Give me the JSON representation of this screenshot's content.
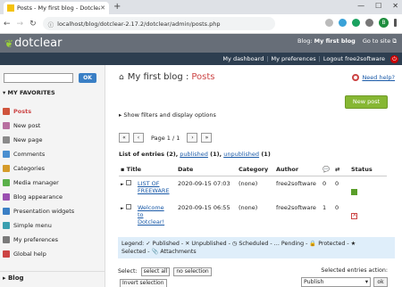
{
  "browser": {
    "tab_title": "Posts - My first blog - Dotclear",
    "url": "localhost/blog/dotclear-2.17.2/dotclear/admin/posts.php",
    "profile_initial": "B"
  },
  "header": {
    "logo": "dotclear",
    "blog_label": "Blog:",
    "blog_name": "My first blog",
    "goto_site": "Go to site",
    "my_dashboard": "My dashboard",
    "my_preferences": "My preferences",
    "logout": "Logout free2software"
  },
  "sidebar": {
    "search_placeholder": "",
    "ok": "OK",
    "favorites_title": "MY FAVORITES",
    "items": [
      {
        "label": "Posts",
        "color": "#d0543c"
      },
      {
        "label": "New post",
        "color": "#b86fa0"
      },
      {
        "label": "New page",
        "color": "#8a8a8a"
      },
      {
        "label": "Comments",
        "color": "#4a8fd0"
      },
      {
        "label": "Categories",
        "color": "#d59b2a"
      },
      {
        "label": "Media manager",
        "color": "#5ab04a"
      },
      {
        "label": "Blog appearance",
        "color": "#9a4fb0"
      },
      {
        "label": "Presentation widgets",
        "color": "#3a7fc5"
      },
      {
        "label": "Simple menu",
        "color": "#3a9fb0"
      },
      {
        "label": "My preferences",
        "color": "#7a7a7a"
      },
      {
        "label": "Global help",
        "color": "#c44"
      }
    ],
    "blog_title": "Blog"
  },
  "main": {
    "blog_name": "My first blog",
    "page_title": "Posts",
    "help": "Need help?",
    "new_post": "New post",
    "filters": "Show filters and display options",
    "pager": {
      "first": "«",
      "prev": "‹",
      "label": "Page 1 / 1",
      "next": "›",
      "last": "»"
    },
    "list_title": {
      "prefix": "List of entries (2),",
      "published": "published",
      "published_count": " (1),",
      "unpublished": "unpublished",
      "unpublished_count": " (1)"
    },
    "columns": [
      "Title",
      "Date",
      "Category",
      "Author",
      "",
      "",
      "Status"
    ],
    "rows": [
      {
        "title": "LIST OF FREEWARE",
        "date": "2020-09-15 07:03",
        "category": "(none)",
        "author": "free2software",
        "comments": "0",
        "trackbacks": "0",
        "status": "published"
      },
      {
        "title": "Welcome to Dotclear!",
        "date": "2020-09-15 06:55",
        "category": "(none)",
        "author": "free2software",
        "comments": "1",
        "trackbacks": "0",
        "status": "unpublished"
      }
    ],
    "legend": {
      "line1": "Legend: ✓ Published - ✕ Unpublished - ◷ Scheduled - … Pending - 🔒 Protected - ★",
      "line2": "Selected - 📎 Attachments"
    },
    "select_label": "Select:",
    "select_all": "select all",
    "no_selection": "no selection",
    "invert_selection": "Invert selection",
    "action_label": "Selected entries action:",
    "action_value": "Publish",
    "action_ok": "ok"
  }
}
